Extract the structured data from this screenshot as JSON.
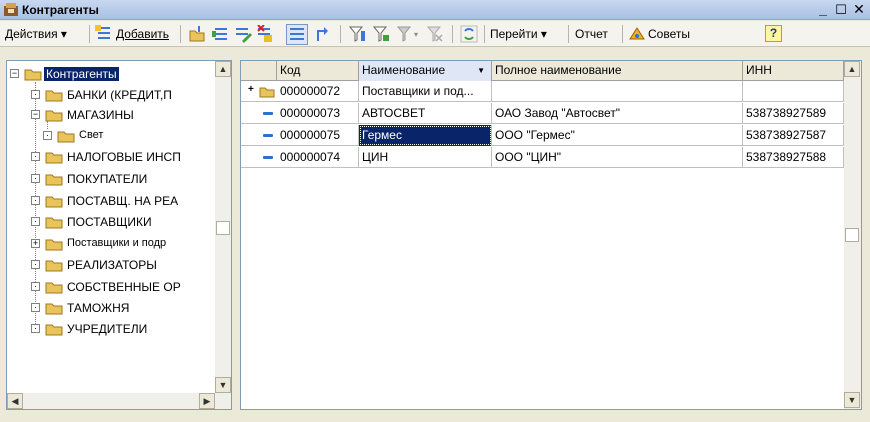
{
  "window": {
    "title": "Контрагенты"
  },
  "toolbar": {
    "actions_label": "Действия ▾",
    "add_label": "Добавить",
    "goto_label": "Перейти ▾",
    "report_label": "Отчет",
    "tips_label": "Советы",
    "help_label": "?"
  },
  "tree": {
    "root": "Контрагенты",
    "items": [
      "БАНКИ (КРЕДИТ,П",
      "МАГАЗИНЫ",
      "Свет",
      "НАЛОГОВЫЕ ИНСП",
      "ПОКУПАТЕЛИ",
      "ПОСТАВЩ. НА РЕА",
      "ПОСТАВЩИКИ",
      "Поставщики и подр",
      "РЕАЛИЗАТОРЫ",
      "СОБСТВЕННЫЕ ОР",
      "ТАМОЖНЯ",
      "УЧРЕДИТЕЛИ"
    ]
  },
  "grid": {
    "columns": [
      "Код",
      "Наименование",
      "Полное наименование",
      "ИНН"
    ],
    "rows": [
      {
        "type": "group",
        "code": "000000072",
        "name": "Поставщики и под...",
        "full_name": "",
        "inn": ""
      },
      {
        "type": "item",
        "code": "000000073",
        "name": "АВТОСВЕТ",
        "full_name": "ОАО Завод \"Автосвет\"",
        "inn": "538738927589"
      },
      {
        "type": "item",
        "code": "000000075",
        "name": "Гермес",
        "full_name": "ООО \"Гермес\"",
        "inn": "538738927587"
      },
      {
        "type": "item",
        "code": "000000074",
        "name": "ЦИН",
        "full_name": "ООО \"ЦИН\"",
        "inn": "538738927588"
      }
    ]
  },
  "colors": {
    "selection": "#0a246a",
    "folder": "#e8c45a",
    "accent": "#2f6fd0"
  }
}
